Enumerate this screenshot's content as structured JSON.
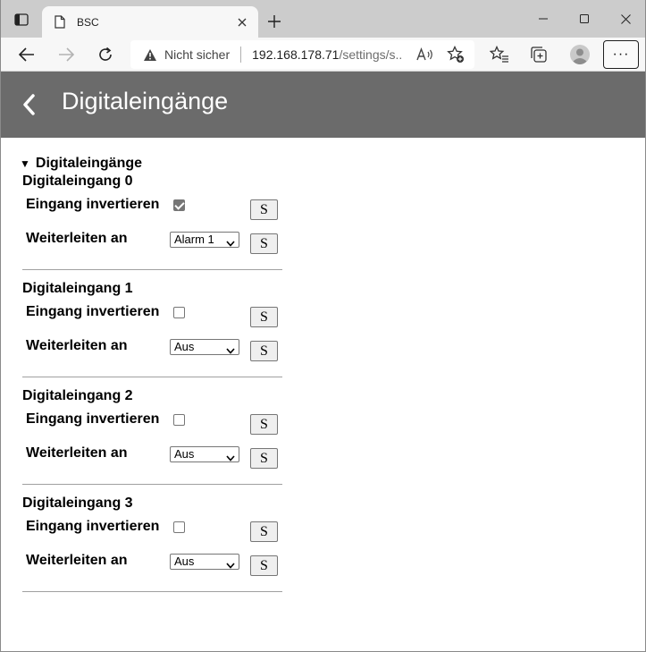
{
  "browser": {
    "tab_title": "BSC",
    "security_label": "Nicht sicher",
    "url_host": "192.168.178.71",
    "url_rest": "/settings/s...",
    "icons": [
      "tab-actions-icon",
      "favicon-icon",
      "close-icon",
      "plus-icon",
      "minimize-icon",
      "maximize-icon",
      "window-close-icon",
      "back-arrow-icon",
      "forward-arrow-icon",
      "refresh-icon",
      "warning-icon",
      "read-aloud-icon",
      "add-favorite-icon",
      "favorites-icon",
      "collections-icon",
      "profile-icon",
      "more-icon"
    ],
    "more_label": "···"
  },
  "page": {
    "title": "Digitaleingänge",
    "back_glyph": "‹",
    "section_label": "Digitaleingänge",
    "invert_label": "Eingang invertieren",
    "forward_label": "Weiterleiten an",
    "save_label": "S",
    "inputs": [
      {
        "title": "Digitaleingang 0",
        "inverted": true,
        "forward_to": "Alarm 1"
      },
      {
        "title": "Digitaleingang 1",
        "inverted": false,
        "forward_to": "Aus"
      },
      {
        "title": "Digitaleingang 2",
        "inverted": false,
        "forward_to": "Aus"
      },
      {
        "title": "Digitaleingang 3",
        "inverted": false,
        "forward_to": "Aus"
      }
    ]
  },
  "colors": {
    "titlebar": "#cccccc",
    "toolbar": "#f7f7f7",
    "appbar": "#6b6b6b",
    "text": "#000000"
  }
}
